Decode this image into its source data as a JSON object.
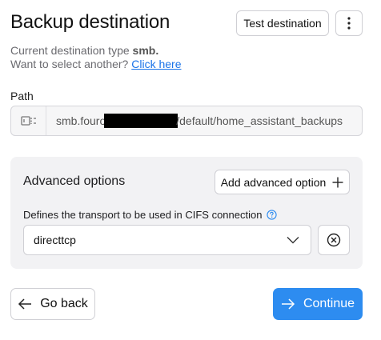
{
  "header": {
    "title": "Backup destination",
    "test_button_label": "Test destination",
    "menu_icon": "kebab-icon"
  },
  "subtitle": {
    "type_prefix": "Current destination type",
    "type_value": "smb.",
    "select_prompt": "Want to select another?",
    "link_text": "Click here"
  },
  "path": {
    "label": "Path",
    "icon": "path-icon",
    "value_prefix": "smb.fouro",
    "value_suffix": "/default/home_assistant_backups"
  },
  "advanced": {
    "title": "Advanced options",
    "add_button_label": "Add advanced option",
    "transport_label": "Defines the transport to be used in CIFS connection",
    "transport_value": "directtcp"
  },
  "footer": {
    "back_label": "Go back",
    "continue_label": "Continue"
  },
  "colors": {
    "accent": "#2d8cf0",
    "link": "#1a73e8",
    "card_bg": "#f2f2f4"
  }
}
